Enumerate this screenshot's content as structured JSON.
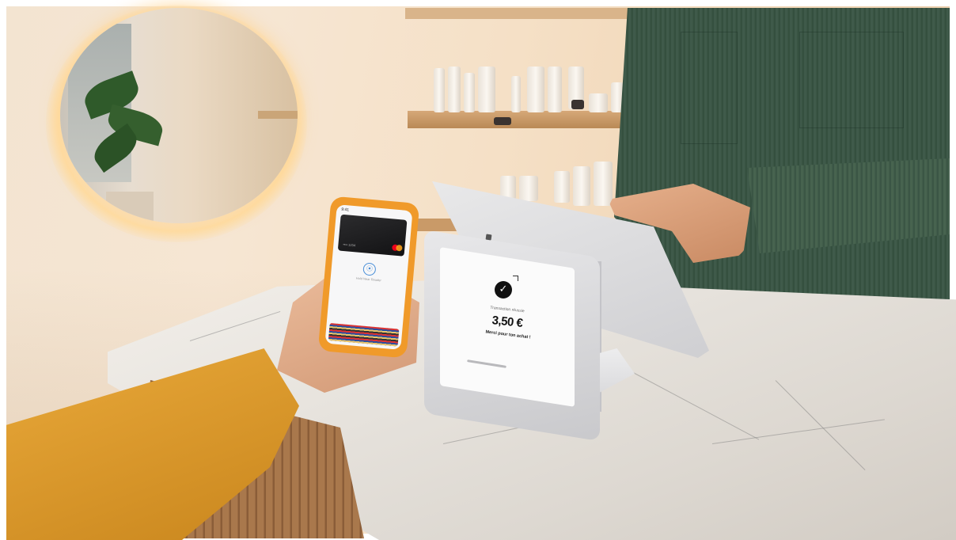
{
  "pos_terminal": {
    "status": "Transaction réussie",
    "amount": "3,50 €",
    "thanks": "Merci pour ton achat !"
  },
  "phone": {
    "status_time": "9:41",
    "card_number": "•••• 1234",
    "contactless_prompt": "Hold Near Reader"
  },
  "icons": [
    "checkmark-icon",
    "contactless-icon",
    "mastercard-logo"
  ],
  "colors": {
    "phone_case": "#f09a2a",
    "sleeve": "#e9a93a",
    "shirt": "#3f5a4a",
    "pos_body": "#e8e8ea"
  }
}
